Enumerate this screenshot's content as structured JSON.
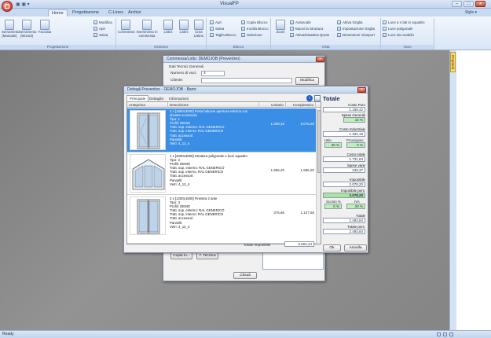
{
  "app": {
    "title": "VisualFP",
    "qat": "▣ ▣ ▾",
    "status": "Ready",
    "style_label": "Style ▾",
    "win_min": "–",
    "win_max": "□",
    "win_close": "x"
  },
  "tabs": [
    "Home",
    "Progettazione",
    "C-Lines",
    "Archivi"
  ],
  "ribbon": {
    "groups": [
      {
        "label": "Progettazione",
        "big": [
          "Serramento (Manuale)",
          "Serramento (Wizard)",
          "Facciata"
        ],
        "small": [
          "Modifica",
          "Apri",
          "Salva"
        ]
      },
      {
        "label": "Gestione",
        "big": [
          "Commesse",
          "Inserimento in commessa",
          "Listini",
          "Listini",
          "Crea Listino"
        ]
      },
      {
        "label": "Blocco",
        "small": [
          "Apri",
          "Salva",
          "Taglia Blocco",
          "Copia Blocco",
          "Incolla Blocco",
          "Selezione"
        ]
      },
      {
        "label": "Vista",
        "big": [
          "Zoom"
        ],
        "small": [
          "Autoscale",
          "Muovi la Struttura",
          "Attiva/Disattiva Quote",
          "Attiva Griglia",
          "Impostazione Griglia",
          "Dimensioni Viewport"
        ]
      },
      {
        "label": "Vano",
        "small": [
          "Luce a 4 lati in squadro",
          "Luce poligonale",
          "Luce da modello"
        ]
      }
    ]
  },
  "side": {
    "properties": "Proprietà"
  },
  "commessa": {
    "title": "Commessa/Lotto: DEMOJOB (Preventivo)",
    "section": "Dati Tecnici Generali",
    "num_voci_label": "Numero di voci:",
    "num_voci": "4",
    "cliente_label": "Cliente:",
    "modifica": "Modifica",
    "copia_in": "Copia in...",
    "t_tecnica": "T. Tecnica",
    "chiudi": "Chiudi"
  },
  "dettagli": {
    "title": "Dettagli Preventivo - DEMOJOB - Barre",
    "tabs": [
      "Principale",
      "Dettaglio",
      "Informazioni"
    ],
    "columns": [
      "Anteprima",
      "Descrizione",
      "Unitario",
      "Complessivo"
    ],
    "rows": [
      {
        "desc": "2 x [1800x3000] Porta balcone apertura esterna con\nalzante scorrevole\nTipo: 1\nProfili: DEMO\nTratt. sup. esterno: RAL GENERICO\nTratt. sup. interno: RAL GENERICO\nTratt. accessori:\nPannelli:\nVetri: 4_12_4",
        "unit": "1.039,10",
        "total": "2.078,20",
        "selected": true
      },
      {
        "desc": "1 x [4000x3000] Struttura poligonale e fuori squadro\nTipo: 2\nProfili: DEMO\nTratt. sup. esterno: RAL GENERICO\nTratt. sup. interno: RAL GENERICO\nTratt. accessori:\nPannelli:\nVetri: 4_12_4",
        "unit": "1.596,20",
        "total": "1.596,20",
        "selected": false
      },
      {
        "desc": "3 x [1200x1500] Finestra 2 ante\nTipo: 3\nProfili: DEMO\nTratt. sup. esterno: RAL GENERICO\nTratt. sup. interno: RAL GENERICO\nTratt. accessori:\nPannelli:\nVetri: 4_12_4",
        "unit": "375,86",
        "total": "1.127,58",
        "selected": false
      }
    ],
    "totale_imponibile_label": "Totale Imponibile",
    "totale_imponibile": "5.604,44",
    "ok": "Ok",
    "annulla": "Annulla",
    "totale": {
      "header": "Totale",
      "costo_puro_label": "Costo Puro",
      "costo_puro": "1.158,42",
      "spese_generali_label": "Spese Generali",
      "spese_generali": "15 %",
      "costo_industriale_label": "Costo Industriale",
      "costo_industriale": "1.332,18",
      "utile_label": "Utile",
      "utile": "30 %",
      "provvigioni_label": "Provvigioni",
      "provvigioni": "0 %",
      "costo_totale_label": "Costo totale",
      "costo_totale": "1.731,83",
      "spese_varie_label": "Spese varie",
      "spese_varie": "346,37",
      "imponibile_label": "Imponibile",
      "imponibile": "2.078,20",
      "imponibile_pers_label": "Imponibile pers.",
      "imponibile_pers": "2.078,20",
      "sconto_label": "Sconto %",
      "sconto": "0 %",
      "iva_label": "IVA",
      "iva": "20 %",
      "totale_label": "Totale",
      "totale": "2.493,84",
      "totale_pers_label": "Totale pers.",
      "totale_pers": "2.493,84"
    }
  }
}
